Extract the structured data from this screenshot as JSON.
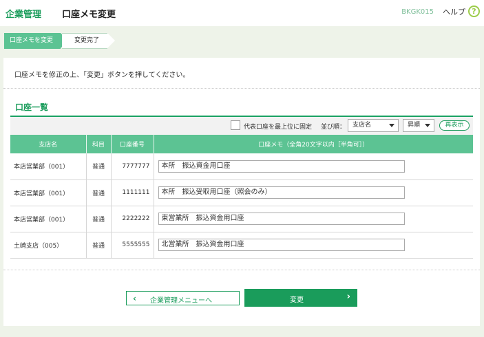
{
  "header": {
    "brand": "企業管理",
    "page_title": "口座メモ変更",
    "screen_id": "BKGK015",
    "help_label": "ヘルプ",
    "help_icon": "?"
  },
  "steps": [
    {
      "label": "口座メモを変更",
      "state": "active"
    },
    {
      "label": "変更完了",
      "state": "inactive"
    }
  ],
  "instruction": "口座メモを修正の上、「変更」ボタンを押してください。",
  "section_title": "口座一覧",
  "options": {
    "pin_label": "代表口座を最上位に固定",
    "pin_checked": false,
    "sort_label": "並び順：",
    "sort_key": "支店名",
    "sort_order": "昇順",
    "redisplay_label": "再表示"
  },
  "table": {
    "headers": [
      "支店名",
      "科目",
      "口座番号",
      "口座メモ（全角20文字以内［半角可］）"
    ],
    "rows": [
      {
        "branch": "本店営業部（001）",
        "type": "普通",
        "number": "7777777",
        "memo": "本所　振込資金用口座"
      },
      {
        "branch": "本店営業部（001）",
        "type": "普通",
        "number": "1111111",
        "memo": "本所　振込受取用口座（照会のみ）"
      },
      {
        "branch": "本店営業部（001）",
        "type": "普通",
        "number": "2222222",
        "memo": "東営業所　振込資金用口座"
      },
      {
        "branch": "土崎支店（005）",
        "type": "普通",
        "number": "5555555",
        "memo": "北営業所　振込資金用口座"
      }
    ]
  },
  "buttons": {
    "back_label": "企業管理メニューへ",
    "submit_label": "変更"
  },
  "colors": {
    "accent": "#1a9c5b",
    "header_fill": "#5cc393"
  }
}
